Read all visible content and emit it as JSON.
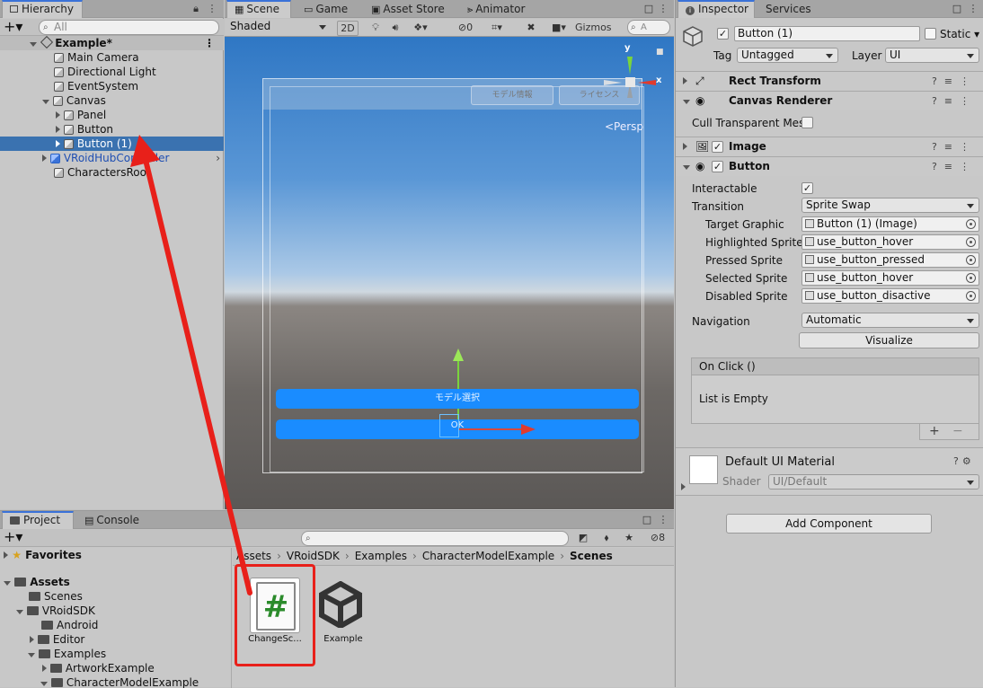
{
  "hierarchy": {
    "tab": "Hierarchy",
    "search_placeholder": "All",
    "scene": "Example*",
    "items": [
      {
        "label": "Main Camera"
      },
      {
        "label": "Directional Light"
      },
      {
        "label": "EventSystem"
      },
      {
        "label": "Canvas"
      },
      {
        "label": "Panel"
      },
      {
        "label": "Button"
      },
      {
        "label": "Button (1)"
      },
      {
        "label": "VRoidHubController"
      },
      {
        "label": "CharactersRoot"
      }
    ]
  },
  "scene_view": {
    "tabs": [
      "Scene",
      "Game",
      "Asset Store",
      "Animator"
    ],
    "shading": "Shaded",
    "mode_2d": "2D",
    "hidden_count": "0",
    "gizmos": "Gizmos",
    "search_placeholder": "A",
    "persp": "<Persp",
    "axis_y": "y",
    "axis_x": "x",
    "top_buttons": [
      "モデル情報",
      "ライセンス"
    ],
    "button_labels": [
      "モデル選択",
      "OK"
    ]
  },
  "inspector": {
    "tabs": [
      "Inspector",
      "Services"
    ],
    "object_name": "Button (1)",
    "static_label": "Static",
    "tag_label": "Tag",
    "tag_value": "Untagged",
    "layer_label": "Layer",
    "layer_value": "UI",
    "components": [
      "Rect Transform",
      "Canvas Renderer",
      "Image",
      "Button"
    ],
    "cull_label": "Cull Transparent Mes",
    "interactable_label": "Interactable",
    "transition_label": "Transition",
    "transition_value": "Sprite Swap",
    "target_graphic_label": "Target Graphic",
    "target_graphic_value": "Button (1) (Image)",
    "highlighted_label": "Highlighted Sprite",
    "highlighted_value": "use_button_hover",
    "pressed_label": "Pressed Sprite",
    "pressed_value": "use_button_pressed",
    "selected_label": "Selected Sprite",
    "selected_value": "use_button_hover",
    "disabled_label": "Disabled Sprite",
    "disabled_value": "use_button_disactive",
    "navigation_label": "Navigation",
    "navigation_value": "Automatic",
    "visualize": "Visualize",
    "onclick": "On Click ()",
    "list_empty": "List is Empty",
    "material_name": "Default UI Material",
    "shader_label": "Shader",
    "shader_value": "UI/Default",
    "add_component": "Add Component"
  },
  "project": {
    "tabs": [
      "Project",
      "Console"
    ],
    "hidden_count": "8",
    "favorites": "Favorites",
    "tree": [
      {
        "label": "Assets"
      },
      {
        "label": "Scenes"
      },
      {
        "label": "VRoidSDK"
      },
      {
        "label": "Android"
      },
      {
        "label": "Editor"
      },
      {
        "label": "Examples"
      },
      {
        "label": "ArtworkExample"
      },
      {
        "label": "CharacterModelExample"
      }
    ],
    "breadcrumb": [
      "Assets",
      "VRoidSDK",
      "Examples",
      "CharacterModelExample",
      "Scenes"
    ],
    "assets": [
      {
        "label": "ChangeSc..."
      },
      {
        "label": "Example"
      }
    ]
  },
  "colors": {
    "highlight": "#3a72b0",
    "annotation": "#e8201a",
    "ui_button": "#1a8cff"
  }
}
